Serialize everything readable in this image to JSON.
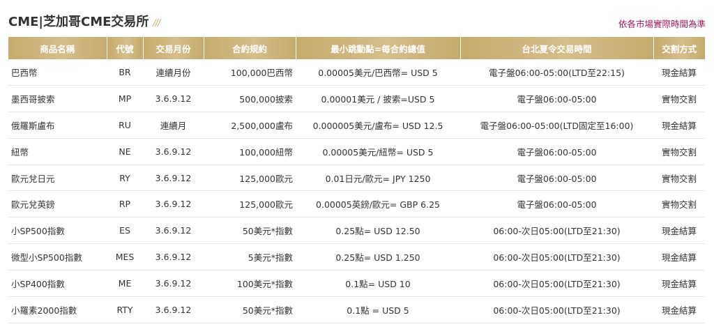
{
  "header": {
    "title": "CME|芝加哥CME交易所",
    "title_decoration": "///",
    "note": "依各市場實際時間為準"
  },
  "colors": {
    "header_gold": "#c9b27a",
    "note_color": "#a0185c"
  },
  "table": {
    "columns": [
      "商品名稱",
      "代號",
      "交易月份",
      "合約規約",
      "最小跳動點=每合約總值",
      "台北夏令交易時間",
      "交割方式"
    ],
    "rows": [
      [
        "巴西幣",
        "BR",
        "連續月份",
        "100,000巴西幣",
        "0.00005美元/巴西幣= USD 5",
        "電子盤06:00-05:00(LTD至22:15)",
        "現金結算"
      ],
      [
        "墨西哥披索",
        "MP",
        "3.6.9.12",
        "500,000披索",
        "0.00001美元 / 披索=USD 5",
        "電子盤06:00-05:00",
        "實物交割"
      ],
      [
        "俄羅斯盧布",
        "RU",
        "連續月",
        "2,500,000盧布",
        "0.000005美元/盧布= USD 12.5",
        "電子盤06:00-05:00(LTD固定至16:00)",
        "現金結算"
      ],
      [
        "紐幣",
        "NE",
        "3.6.9.12",
        "100,000紐幣",
        "0.00005美元/紐幣= USD 5",
        "電子盤06:00-05:00",
        "實物交割"
      ],
      [
        "歐元兌日元",
        "RY",
        "3.6.9.12",
        "125,000歐元",
        "0.01日元/歐元= JPY 1250",
        "電子盤06:00-05:00",
        "實物交割"
      ],
      [
        "歐元兌英鎊",
        "RP",
        "3.6.9.12",
        "125,000歐元",
        "0.00005英鎊/歐元= GBP 6.25",
        "電子盤06:00-05:00",
        "實物交割"
      ],
      [
        "小SP500指數",
        "ES",
        "3.6.9.12",
        "50美元*指數",
        "0.25點= USD 12.50",
        "06:00-次日05:00(LTD至21:30)",
        "現金結算"
      ],
      [
        "微型小SP500指數",
        "MES",
        "3.6.9.12",
        "5美元*指數",
        "0.25點= USD 1.250",
        "06:00-次日05:00(LTD至21:30)",
        "現金結算"
      ],
      [
        "小SP400指數",
        "ME",
        "3.6.9.12",
        "100美元*指數",
        "0.1點= USD 10",
        "06:00-次日05:00(LTD至21:30)",
        "現金結算"
      ],
      [
        "小羅素2000指數",
        "RTY",
        "3.6.9.12",
        "50美元*指數",
        "0.1點 = USD 5",
        "06:00-次日05:00(LTD至21:30)",
        "現金結算"
      ]
    ]
  }
}
